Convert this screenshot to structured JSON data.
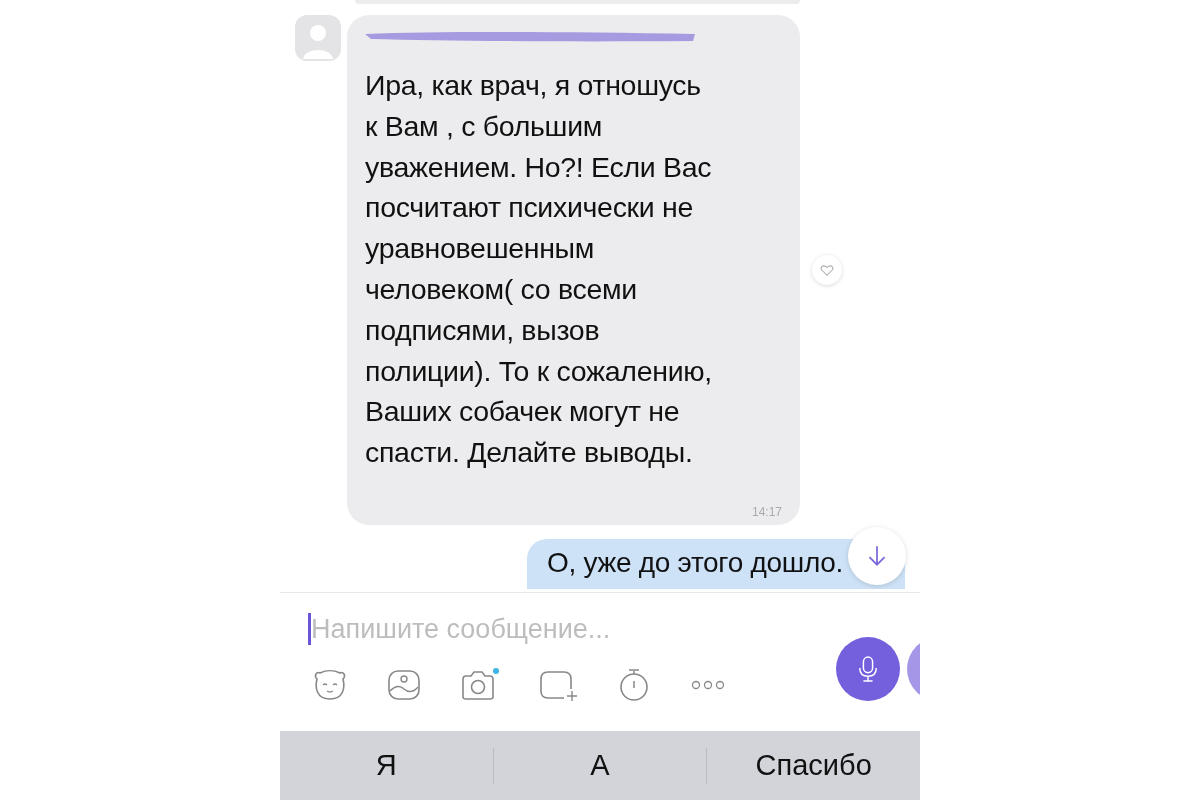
{
  "messages": [
    {
      "kind": "incoming",
      "text": "Ира, как врач, я отношусь\nк Вам , с большим\nуважением. Но?! Если Вас\nпосчитают психически не\nуравновешенным\nчеловеком( со всеми\nподписями, вызов\nполиции). То к сожалению,\nВаших собачек могут не\nспасти. Делайте выводы.",
      "time": "14:17"
    },
    {
      "kind": "outgoing",
      "text": "О, уже до этого дошло."
    }
  ],
  "composer": {
    "placeholder": "Напишите сообщение..."
  },
  "suggestions": [
    "Я",
    "А",
    "Спасибо"
  ]
}
